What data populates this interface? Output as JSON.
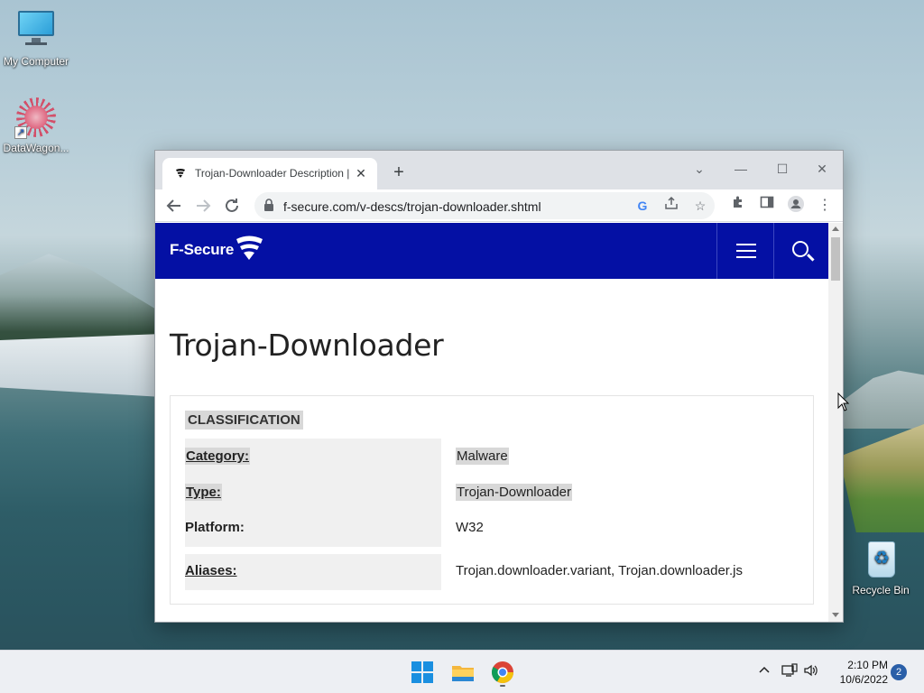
{
  "desktop": {
    "icons": [
      {
        "label": "My Computer",
        "icon": "computer-icon"
      },
      {
        "label": "DataWagon...",
        "icon": "datawagon-icon"
      },
      {
        "label": "Recycle Bin",
        "icon": "recycle-bin-icon"
      }
    ]
  },
  "browser": {
    "tab": {
      "title": "Trojan-Downloader Description |",
      "favicon": "f-secure-favicon"
    },
    "window_controls": {
      "dropdown": "⌄",
      "minimize": "—",
      "maximize": "☐",
      "close": "✕"
    },
    "url": "f-secure.com/v-descs/trojan-downloader.shtml",
    "omnibox_icons": [
      "google-lens-icon",
      "share-icon",
      "bookmark-star-icon"
    ],
    "toolbar_icons": [
      "extensions-icon",
      "side-panel-icon",
      "profile-icon",
      "menu-icon"
    ]
  },
  "site": {
    "brand": "F-Secure",
    "brand_color": "#0410a4",
    "page_title": "Trojan-Downloader",
    "classification": {
      "heading": "CLASSIFICATION",
      "rows": [
        {
          "label": "Category:",
          "value": "Malware"
        },
        {
          "label": "Type:",
          "value": "Trojan-Downloader"
        },
        {
          "label": "Platform:",
          "value": "W32"
        },
        {
          "label": "Aliases:",
          "value": "Trojan.downloader.variant, Trojan.downloader.js"
        }
      ]
    }
  },
  "taskbar": {
    "apps": [
      "start-icon",
      "file-explorer-icon",
      "chrome-icon"
    ],
    "tray": {
      "time": "2:10 PM",
      "date": "10/6/2022",
      "notifications": "2"
    }
  }
}
